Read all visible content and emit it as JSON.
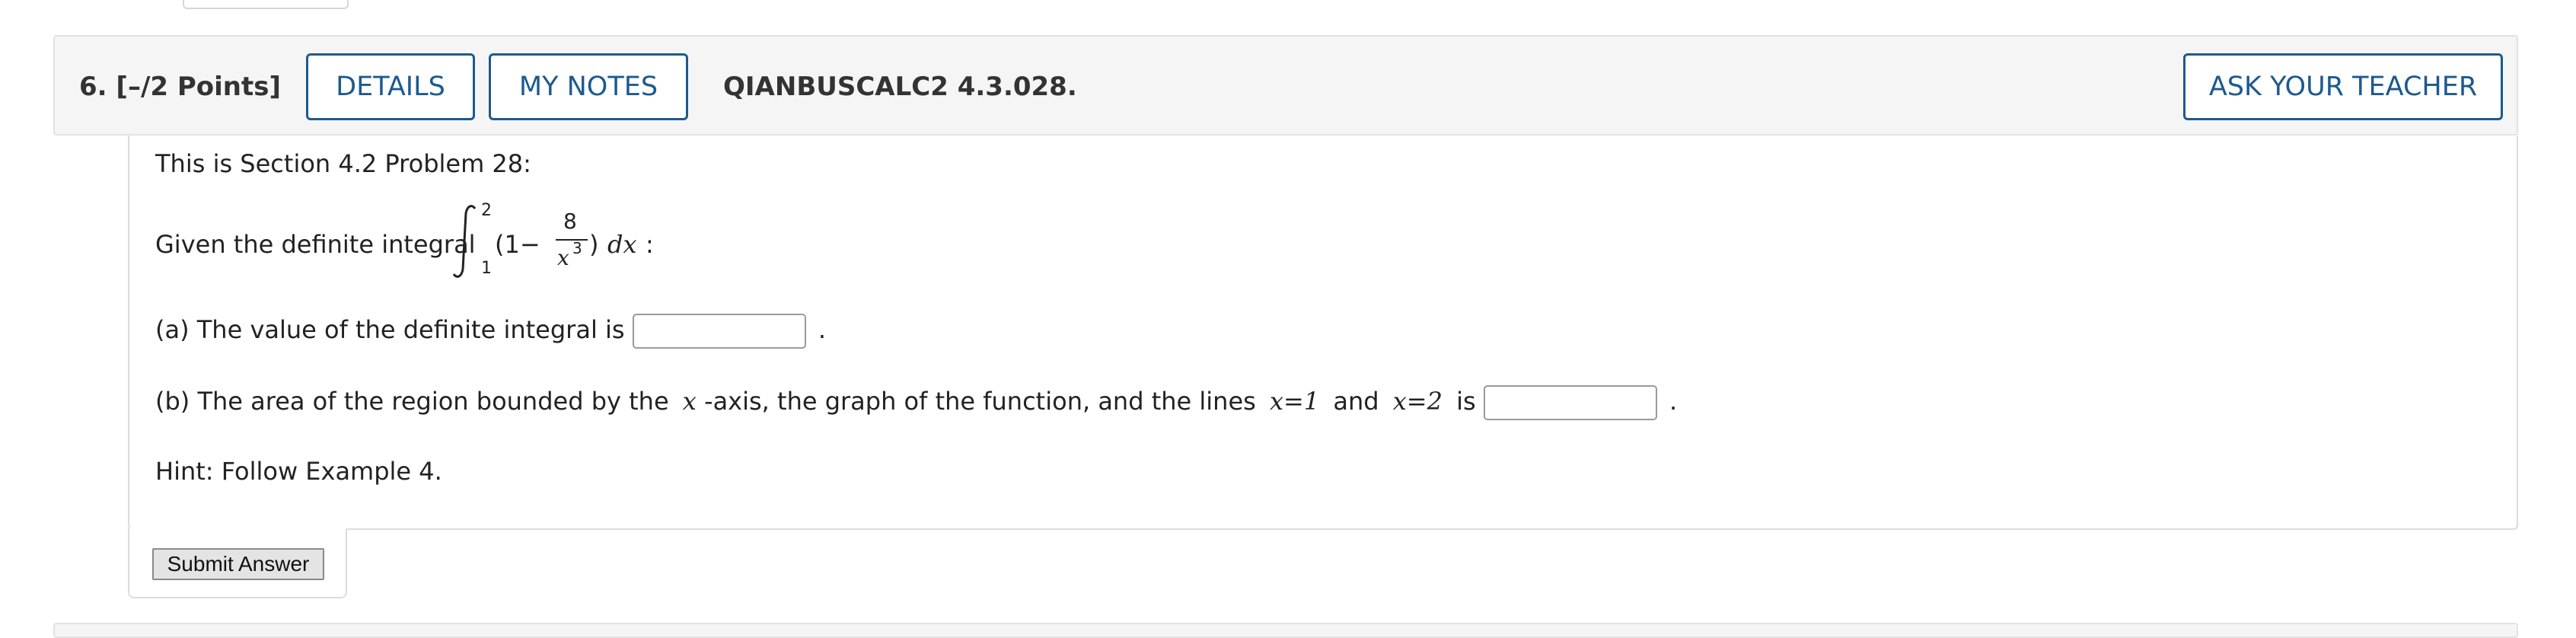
{
  "question": {
    "number_points": "6.  [–/2 Points]",
    "details_label": "DETAILS",
    "my_notes_label": "MY NOTES",
    "code": "QIANBUSCALC2 4.3.028.",
    "ask_teacher_label": "ASK YOUR TEACHER"
  },
  "body": {
    "intro": "This is Section 4.2 Problem 28:",
    "given_prefix": "Given the definite integral",
    "integral": {
      "upper": "2",
      "lower": "1",
      "open": "(1−",
      "numerator": "8",
      "denominator": "x",
      "exponent": "3",
      "close": ")",
      "dx": "dx",
      "suffix": ":"
    },
    "part_a": "(a) The value of the definite integral is",
    "part_a_value": "",
    "part_b_prefix": "(b) The area of the region bounded by the",
    "part_b_x": "x",
    "part_b_mid": "-axis, the graph of the function, and the lines",
    "part_b_line1": "x=1",
    "part_b_and": "and",
    "part_b_line2": "x=2",
    "part_b_is": "is",
    "part_b_value": "",
    "period": ".",
    "hint": "Hint: Follow Example 4."
  },
  "submit_label": "Submit Answer"
}
